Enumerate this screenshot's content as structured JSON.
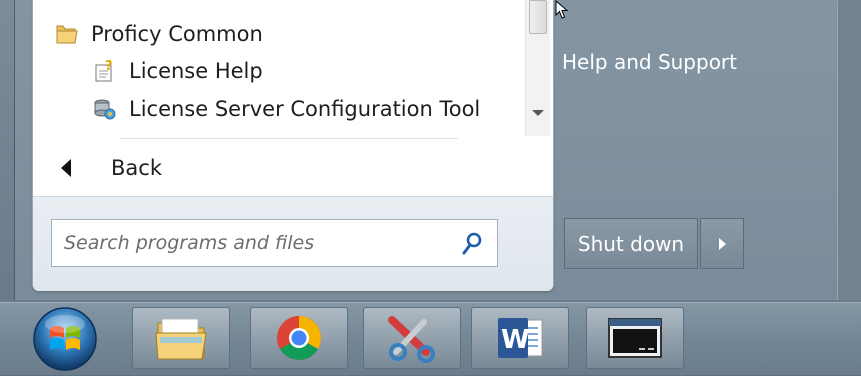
{
  "start_menu": {
    "programs": [
      {
        "label": "Proficy Common",
        "icon": "folder-icon"
      },
      {
        "label": "License Help",
        "icon": "help-file-icon"
      },
      {
        "label": "License Server Configuration Tool",
        "icon": "server-config-icon"
      }
    ],
    "back_label": "Back",
    "search": {
      "placeholder": "Search programs and files"
    },
    "right_pane": {
      "help_support": "Help and Support"
    },
    "shutdown_label": "Shut down"
  },
  "taskbar": {
    "buttons": [
      {
        "icon": "file-explorer-icon"
      },
      {
        "icon": "chrome-icon"
      },
      {
        "icon": "snipping-tool-icon"
      },
      {
        "icon": "word-icon"
      },
      {
        "icon": "command-window-icon"
      }
    ]
  },
  "colors": {
    "accent": "#1f5fa8",
    "panel": "#7b8c9a"
  }
}
